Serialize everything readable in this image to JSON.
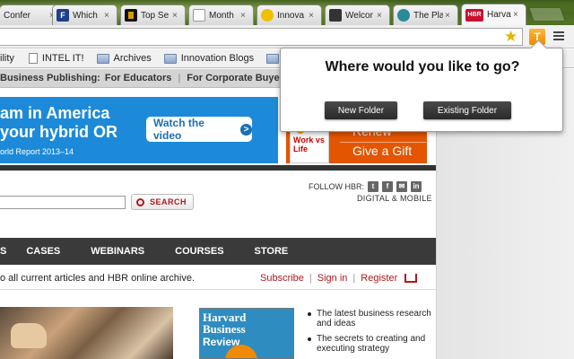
{
  "browser": {
    "tabs": [
      {
        "title": "Confer",
        "favicon": "",
        "favicon_color": "#7a9a3a"
      },
      {
        "title": "Which",
        "favicon": "F",
        "favicon_color": "#1e3f8a"
      },
      {
        "title": "Top Se",
        "favicon": "",
        "favicon_color": "#111111"
      },
      {
        "title": "Month",
        "favicon": "",
        "favicon_color": "#ffffff"
      },
      {
        "title": "Innova",
        "favicon": "",
        "favicon_color": "#f0c000"
      },
      {
        "title": "Welcor",
        "favicon": "",
        "favicon_color": "#333333"
      },
      {
        "title": "The Pla",
        "favicon": "",
        "favicon_color": "#2a8a9a"
      },
      {
        "title": "Harvarc",
        "favicon": "HBR",
        "favicon_color": "#c8102e",
        "active": true
      }
    ],
    "close_glyph": "×",
    "toolbar": {
      "star_icon": "star-icon",
      "extension_icon_glyph": "T",
      "menu_icon": "menu-icon"
    },
    "bookmarks": [
      {
        "label": "ility",
        "icon": ""
      },
      {
        "label": "INTEL IT!",
        "icon": "page"
      },
      {
        "label": "Archives",
        "icon": "folder"
      },
      {
        "label": "Innovation Blogs",
        "icon": "folder"
      },
      {
        "label": "E",
        "icon": "folder"
      }
    ]
  },
  "site": {
    "top_nav": {
      "items": [
        "Business Publishing:",
        "For Educators",
        "For Corporate Buyers"
      ],
      "separator": "|"
    },
    "banner": {
      "line1": "am in America",
      "line2": "your hybrid OR",
      "line3": "orld Report 2013–14",
      "cta_label": "Watch the video",
      "cta_arrow": ">",
      "bg_color": "#1c8ad8"
    },
    "promo": {
      "book_label": "Work vs Life",
      "renew_label": "Renew",
      "gift_label": "Give a Gift",
      "bg_color": "#e35500"
    },
    "search": {
      "value": "",
      "button_label": "SEARCH"
    },
    "social": {
      "follow_label": "FOLLOW HBR:",
      "icons": [
        "t",
        "f",
        "✉",
        "in"
      ],
      "digital_label": "DIGITAL & MOBILE"
    },
    "main_nav": [
      "S",
      "CASES",
      "WEBINARS",
      "COURSES",
      "STORE"
    ],
    "access_text": "o all current articles and HBR online archive.",
    "account_links": [
      "Subscribe",
      "Sign in",
      "Register"
    ],
    "account_separator": "|",
    "magazine": {
      "title_line1": "Harvard",
      "title_line2": "Business",
      "title_line3": "Review"
    },
    "bullets": [
      "The latest business research and ideas",
      "The secrets to creating and executing strategy"
    ]
  },
  "popup": {
    "heading": "Where would you like to go?",
    "new_folder_label": "New Folder",
    "existing_folder_label": "Existing Folder"
  }
}
